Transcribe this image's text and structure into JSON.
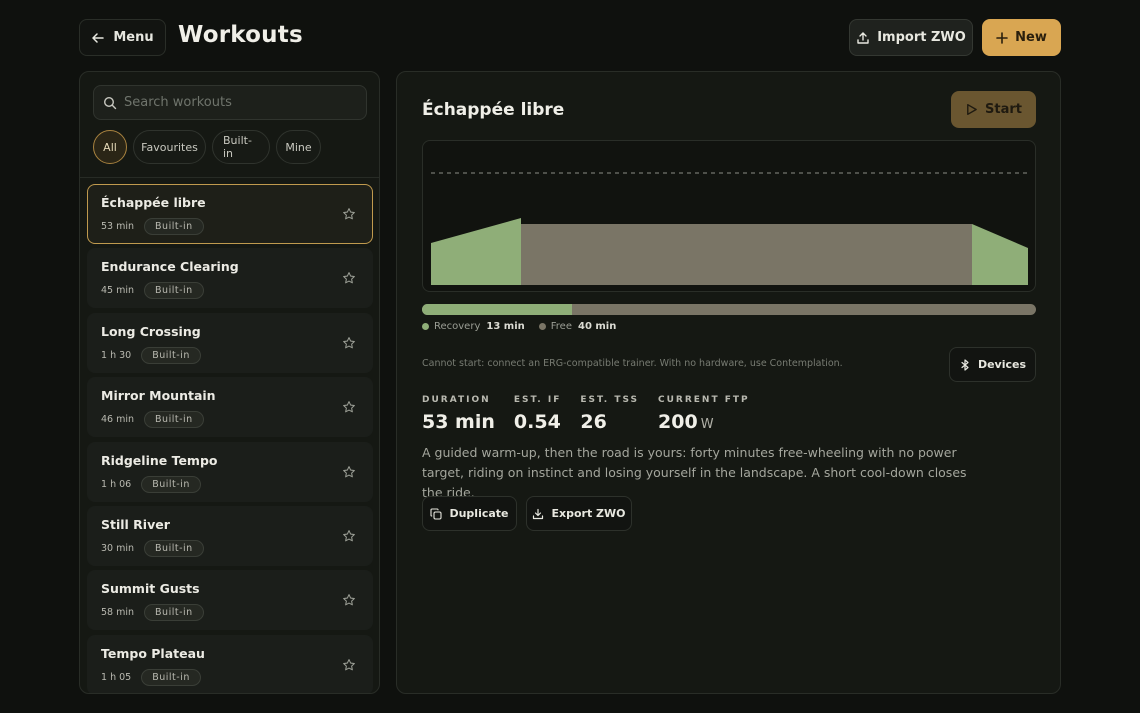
{
  "header": {
    "menu_label": "Menu",
    "title": "Workouts",
    "import_label": "Import ZWO",
    "new_label": "New"
  },
  "search": {
    "placeholder": "Search workouts",
    "value": ""
  },
  "filters": [
    {
      "label": "All",
      "active": true
    },
    {
      "label": "Favourites",
      "active": false
    },
    {
      "label": "Built-in",
      "active": false
    },
    {
      "label": "Mine",
      "active": false
    }
  ],
  "workouts": [
    {
      "name": "Échappée libre",
      "duration": "53 min",
      "badge": "Built-in",
      "selected": true
    },
    {
      "name": "Endurance Clearing",
      "duration": "45 min",
      "badge": "Built-in",
      "selected": false
    },
    {
      "name": "Long Crossing",
      "duration": "1 h 30",
      "badge": "Built-in",
      "selected": false
    },
    {
      "name": "Mirror Mountain",
      "duration": "46 min",
      "badge": "Built-in",
      "selected": false
    },
    {
      "name": "Ridgeline Tempo",
      "duration": "1 h 06",
      "badge": "Built-in",
      "selected": false
    },
    {
      "name": "Still River",
      "duration": "30 min",
      "badge": "Built-in",
      "selected": false
    },
    {
      "name": "Summit Gusts",
      "duration": "58 min",
      "badge": "Built-in",
      "selected": false
    },
    {
      "name": "Tempo Plateau",
      "duration": "1 h 05",
      "badge": "Built-in",
      "selected": false
    }
  ],
  "detail": {
    "title": "Échappée libre",
    "start_label": "Start",
    "progress_fraction": 0.245,
    "segments": [
      {
        "name": "Recovery",
        "value": "13 min",
        "color": "#8fae78"
      },
      {
        "name": "Free",
        "value": "40 min",
        "color": "#7a7566"
      }
    ],
    "notice": "Cannot start: connect an ERG-compatible trainer. With no hardware, use Contemplation.",
    "devices_label": "Devices",
    "stats": [
      {
        "label": "DURATION",
        "value": "53 min",
        "unit": ""
      },
      {
        "label": "EST. IF",
        "value": "0.54",
        "unit": ""
      },
      {
        "label": "EST. TSS",
        "value": "26",
        "unit": ""
      },
      {
        "label": "CURRENT FTP",
        "value": "200",
        "unit": "W"
      }
    ],
    "description": "A guided warm-up, then the road is yours: forty minutes free-wheeling with no power target, riding on instinct and losing yourself in the landscape. A short cool-down closes the ride.",
    "duplicate_label": "Duplicate",
    "export_label": "Export ZWO"
  },
  "colors": {
    "accent": "#d9a652",
    "recovery": "#8fae78",
    "free": "#7a7566"
  }
}
